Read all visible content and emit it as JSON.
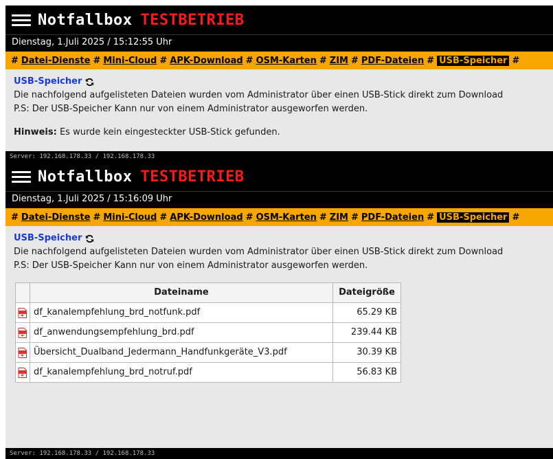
{
  "shot1": {
    "app_name": "Notfallbox",
    "mode": "TESTBETRIEB",
    "datetime": "Dienstag, 1.Juli 2025 / 15:12:55 Uhr",
    "nav": [
      "Datei-Dienste",
      "Mini-Cloud",
      "APK-Download",
      "OSM-Karten",
      "ZIM",
      "PDF-Dateien",
      "USB-Speicher"
    ],
    "active_nav": "USB-Speicher",
    "page_title": "USB-Speicher",
    "description": "Die nachfolgend aufgelisteten Dateien wurden vom Administrator über einen USB-Stick direkt zum Download",
    "ps": "P.S: Der USB-Speicher Kann nur von einem Administrator ausgeworfen werden.",
    "hint_label": "Hinweis:",
    "hint_text": "Es wurde kein eingesteckter USB-Stick gefunden.",
    "server": "Server: 192.168.178.33 / 192.168.178.33"
  },
  "shot2": {
    "app_name": "Notfallbox",
    "mode": "TESTBETRIEB",
    "datetime": "Dienstag, 1.Juli 2025 / 15:16:09 Uhr",
    "nav": [
      "Datei-Dienste",
      "Mini-Cloud",
      "APK-Download",
      "OSM-Karten",
      "ZIM",
      "PDF-Dateien",
      "USB-Speicher"
    ],
    "active_nav": "USB-Speicher",
    "page_title": "USB-Speicher",
    "description": "Die nachfolgend aufgelisteten Dateien wurden vom Administrator über einen USB-Stick direkt zum Download",
    "ps": "P.S: Der USB-Speicher Kann nur von einem Administrator ausgeworfen werden.",
    "table": {
      "headers": [
        "Dateiname",
        "Dateigröße"
      ],
      "rows": [
        {
          "name": "df_kanalempfehlung_brd_notfunk.pdf",
          "size": "65.29 KB"
        },
        {
          "name": "df_anwendungsempfehlung_brd.pdf",
          "size": "239.44 KB"
        },
        {
          "name": "Übersicht_Dualband_Jedermann_Handfunkgeräte_V3.pdf",
          "size": "30.39 KB"
        },
        {
          "name": "df_kanalempfehlung_brd_notruf.pdf",
          "size": "56.83 KB"
        }
      ]
    },
    "server": "Server: 192.168.178.33 / 192.168.178.33"
  },
  "colors": {
    "header_bg": "#000000",
    "nav_bg": "#f7a600",
    "mode_red": "#ff1a1a",
    "title_blue": "#1a3ad8"
  },
  "icons": {
    "menu": "hamburger-icon",
    "refresh": "refresh-icon",
    "file": "pdf-file-icon"
  }
}
